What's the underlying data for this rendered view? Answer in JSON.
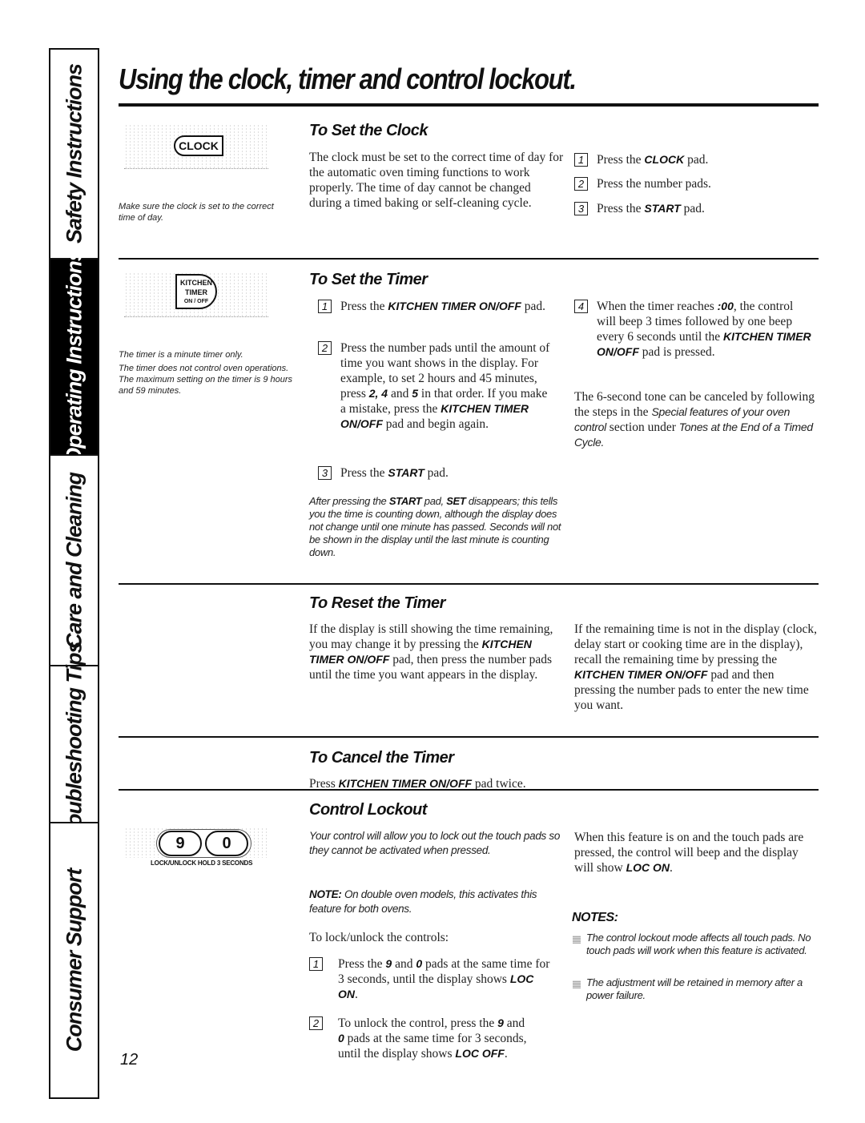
{
  "side_tabs": [
    {
      "label": "Safety Instructions",
      "active": false
    },
    {
      "label": "Operating Instructions",
      "active": true
    },
    {
      "label": "Care and Cleaning",
      "active": false
    },
    {
      "label": "Troubleshooting Tips",
      "active": false
    },
    {
      "label": "Consumer Support",
      "active": false
    }
  ],
  "page_title": "Using the clock, timer and control lockout.",
  "page_number": "12",
  "set_clock": {
    "heading": "To Set the Clock",
    "pad_label": "CLOCK",
    "caption": "Make sure the clock is set to the correct time of day.",
    "body": "The clock must be set to the correct time of day for the automatic oven timing functions to work properly. The time of day cannot be changed during a timed baking or self-cleaning cycle.",
    "steps": [
      {
        "num": "1",
        "pre": "Press the ",
        "bold": "CLOCK",
        "post": " pad."
      },
      {
        "num": "2",
        "pre": "Press the number pads.",
        "bold": "",
        "post": ""
      },
      {
        "num": "3",
        "pre": "Press the ",
        "bold": "START",
        "post": " pad."
      }
    ]
  },
  "set_timer": {
    "heading": "To Set the Timer",
    "pad_label_1": "KITCHEN",
    "pad_label_2": "TIMER",
    "pad_label_3": "ON / OFF",
    "caption_1": "The timer is a minute timer only.",
    "caption_2": "The timer does not control oven operations. The maximum setting on the timer is 9 hours and 59 minutes.",
    "step1_pre": "Press the ",
    "step1_bold": "KITCHEN TIMER ON/OFF",
    "step1_post": " pad.",
    "step2_a": "Press the number pads until the amount of time you want shows in the display. For example, to set 2 hours and 45 minutes, press ",
    "step2_b": "2, 4",
    "step2_c": " and ",
    "step2_d": "5",
    "step2_e": " in that order. If you make a mistake, press the ",
    "step2_f": "KITCHEN TIMER ON/OFF",
    "step2_g": " pad and begin again.",
    "step3_pre": "Press the ",
    "step3_bold": "START",
    "step3_post": " pad.",
    "note_a": "After pressing the ",
    "note_b": "START",
    "note_c": " pad, ",
    "note_d": "SET",
    "note_e": " disappears; this tells you the time is counting down, although the display does not change until one minute has passed. Seconds will not be shown in the display until the last minute is counting down.",
    "step4_a": "When the timer reaches ",
    "step4_b": ":00",
    "step4_c": ", the control will beep 3 times followed by one beep every 6 seconds until the ",
    "step4_d": "KITCHEN TIMER ON/OFF",
    "step4_e": " pad is pressed.",
    "tone_a": "The 6-second tone can be canceled by following the steps in the ",
    "tone_b": "Special features of your oven control",
    "tone_c": " section under ",
    "tone_d": "Tones at the End of a Timed Cycle."
  },
  "reset_timer": {
    "heading": "To Reset the Timer",
    "left_a": "If the display is still showing the time remaining, you may change it by pressing the ",
    "left_b": "KITCHEN TIMER ON/OFF",
    "left_c": " pad, then press the number pads until the time you want appears in the display.",
    "right_a": "If the remaining time is not in the display (clock, delay start or cooking time are in the display), recall the remaining time by pressing the ",
    "right_b": "KITCHEN TIMER ON/OFF",
    "right_c": " pad and then pressing the number pads to enter the new time you want."
  },
  "cancel_timer": {
    "heading": "To Cancel the Timer",
    "pre": "Press ",
    "bold": "KITCHEN TIMER ON/OFF",
    "post": " pad twice."
  },
  "lockout": {
    "heading": "Control Lockout",
    "pad_9": "9",
    "pad_0": "0",
    "pad_caption": "LOCK/UNLOCK HOLD 3 SECONDS",
    "intro": "Your control will allow you to lock out the touch pads so they cannot be activated when pressed.",
    "note_bold": "NOTE:",
    "note_text": " On double oven models, this activates this feature for both ovens.",
    "lead": "To lock/unlock the controls:",
    "step1_a": "Press the ",
    "step1_b": "9",
    "step1_c": " and ",
    "step1_d": "0",
    "step1_e": " pads at the same time for 3 seconds, until the display shows ",
    "step1_f": "LOC ON",
    "step1_g": ".",
    "step2_a": "To unlock the control, press the ",
    "step2_b": "9",
    "step2_c": " and ",
    "step2_d": "0",
    "step2_e": " pads at the same time for 3 seconds, until the display shows ",
    "step2_f": "LOC OFF",
    "step2_g": ".",
    "right_a": "When this feature is on and the touch pads are pressed, the control will beep and the display will show ",
    "right_b": "LOC ON",
    "right_c": ".",
    "notes_heading": "NOTES:",
    "notes": [
      "The control lockout mode affects all touch pads. No touch pads will work when this feature is activated.",
      "The adjustment will be retained in memory after a power failure."
    ]
  }
}
